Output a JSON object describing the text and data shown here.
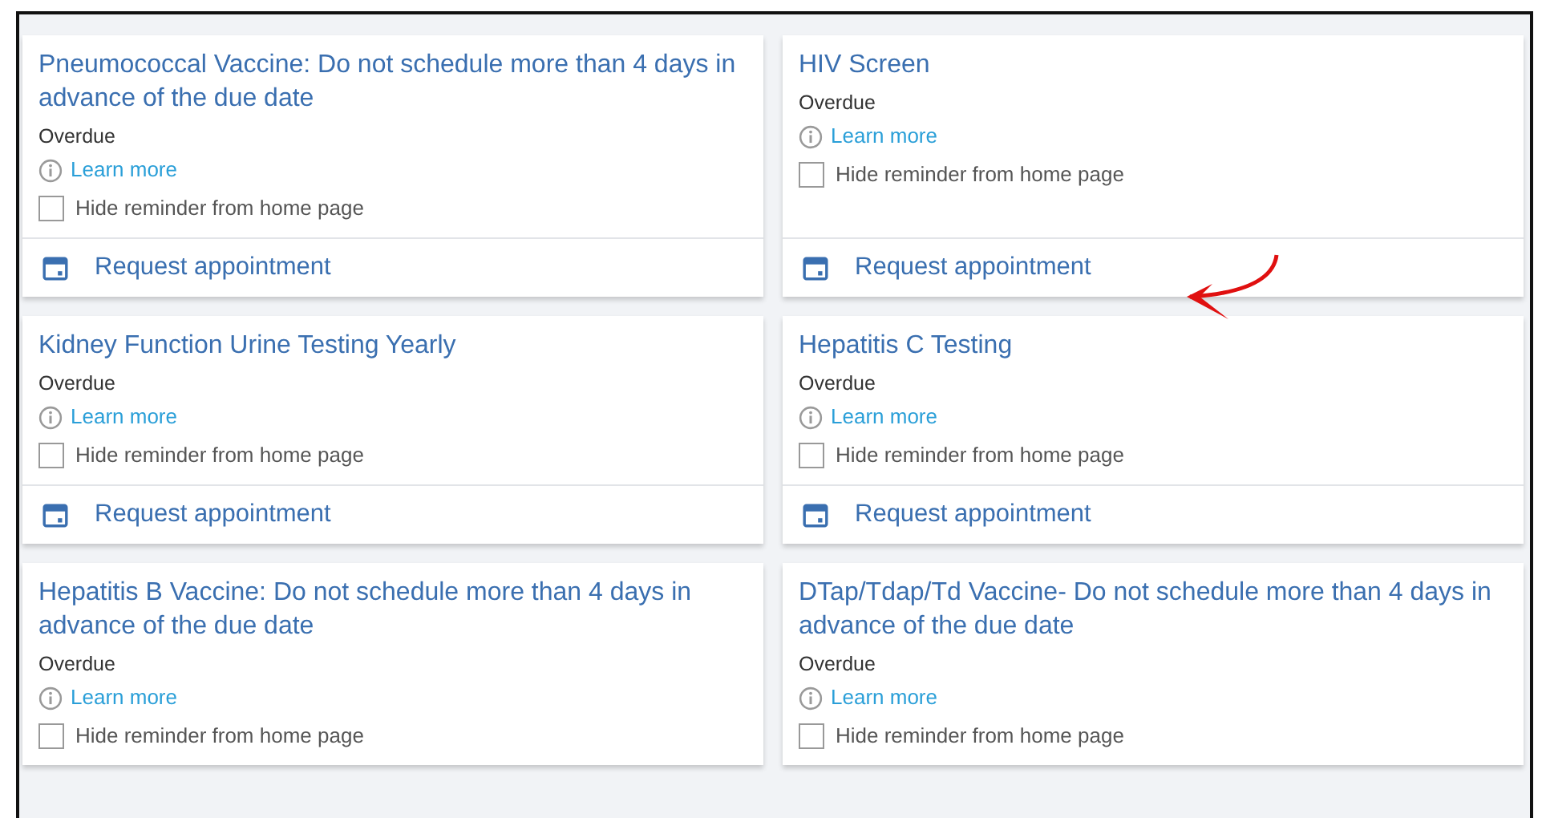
{
  "reminders": [
    {
      "title": "Pneumococcal Vaccine: Do not schedule more than 4 days in advance of the due date",
      "status": "Overdue",
      "learn_more": "Learn more",
      "hide_label": "Hide reminder from home page",
      "hide_checked": false,
      "action": "Request appointment"
    },
    {
      "title": "HIV Screen",
      "status": "Overdue",
      "learn_more": "Learn more",
      "hide_label": "Hide reminder from home page",
      "hide_checked": false,
      "action": "Request appointment"
    },
    {
      "title": "Kidney Function Urine Testing Yearly",
      "status": "Overdue",
      "learn_more": "Learn more",
      "hide_label": "Hide reminder from home page",
      "hide_checked": false,
      "action": "Request appointment"
    },
    {
      "title": "Hepatitis C Testing",
      "status": "Overdue",
      "learn_more": "Learn more",
      "hide_label": "Hide reminder from home page",
      "hide_checked": false,
      "action": "Request appointment"
    },
    {
      "title": "Hepatitis B Vaccine: Do not schedule more than 4 days in advance of the due date",
      "status": "Overdue",
      "learn_more": "Learn more",
      "hide_label": "Hide reminder from home page",
      "hide_checked": false
    },
    {
      "title": "DTap/Tdap/Td Vaccine- Do not schedule more than 4 days in advance of the due date",
      "status": "Overdue",
      "learn_more": "Learn more",
      "hide_label": "Hide reminder from home page",
      "hide_checked": false
    }
  ]
}
